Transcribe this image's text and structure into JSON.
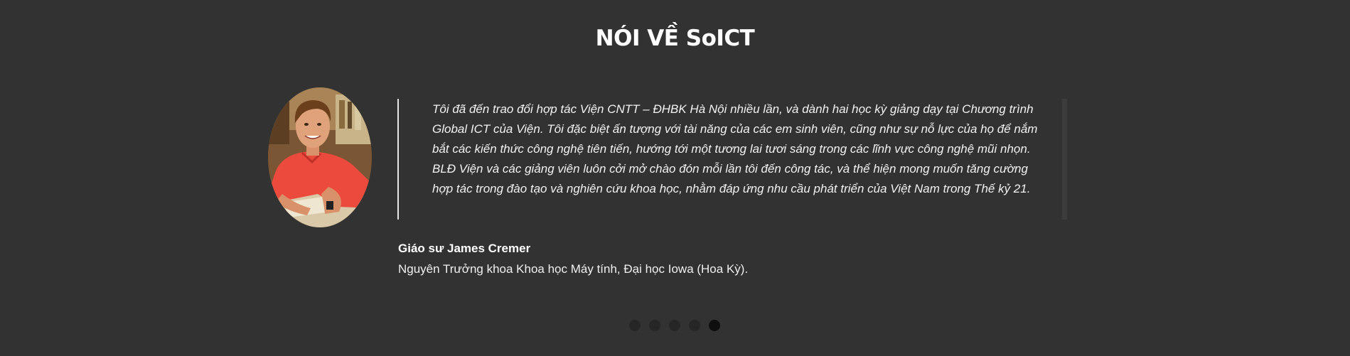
{
  "section": {
    "title": "NÓI VỀ SoICT"
  },
  "testimonial": {
    "quote": "Tôi đã đến trao đổi hợp tác Viện CNTT – ĐHBK Hà Nội nhiều lần, và dành hai học kỳ giảng dạy tại Chương trình Global ICT của Viện. Tôi đặc biệt ấn tượng với tài năng của các em sinh viên, cũng như sự nỗ lực của họ để nắm bắt các kiến thức công nghệ tiên tiến, hướng tới một tương lai tươi sáng trong các lĩnh vực công nghệ mũi nhọn. BLĐ Viện và các giảng viên luôn cởi mở chào đón mỗi lần tôi đến công tác, và thể hiện mong muốn tăng cường hợp tác trong đào tạo và nghiên cứu khoa học, nhằm đáp ứng nhu cầu phát triển của Việt Nam trong Thế kỷ 21.",
    "author_name": "Giáo sư James Cremer",
    "author_role": "Nguyên Trưởng khoa Khoa học Máy tính, Đại học Iowa (Hoa Kỳ).",
    "avatar_icon": "person-photo"
  },
  "carousel": {
    "slide_count": 5,
    "active_index": 4
  },
  "colors": {
    "background": "#323232",
    "text": "#ffffff",
    "dot_inactive": "#262626",
    "dot_active": "#0f0f0f"
  }
}
